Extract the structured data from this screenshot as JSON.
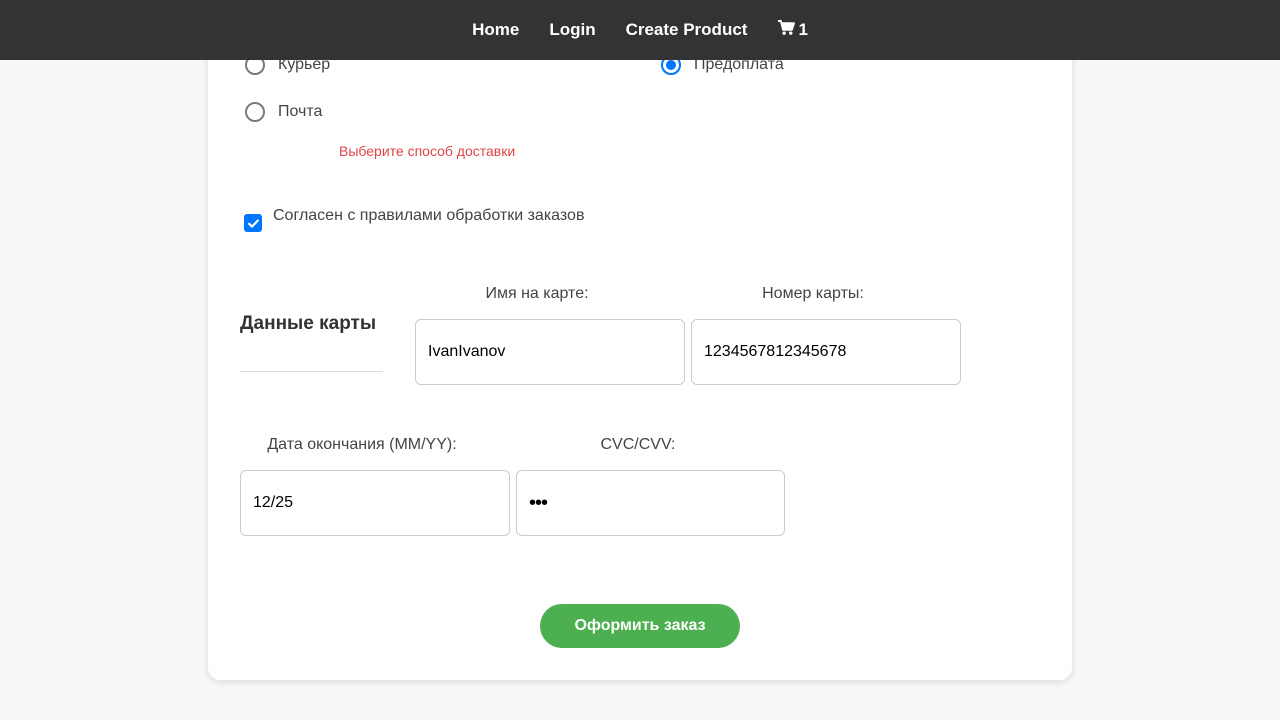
{
  "nav": {
    "home": "Home",
    "login": "Login",
    "create_product": "Create Product",
    "cart_count": "1"
  },
  "delivery": {
    "options": [
      "Курьер",
      "Почта"
    ],
    "error": "Выберите способ доставки"
  },
  "payment": {
    "selected": "Предоплата"
  },
  "agreement": {
    "label": "Согласен с правилами обработки заказов",
    "checked": true
  },
  "card": {
    "title": "Данные карты",
    "name_label": "Имя на карте:",
    "name_value": "IvanIvanov",
    "number_label": "Номер карты:",
    "number_value": "1234567812345678",
    "expiry_label": "Дата окончания (MM/YY):",
    "expiry_value": "12/25",
    "cvc_label": "CVC/CVV:",
    "cvc_value": "•••"
  },
  "submit_label": "Оформить заказ",
  "colors": {
    "navbar": "#333333",
    "accent": "#0075ff",
    "submit": "#4caf50",
    "error": "#e04545"
  }
}
